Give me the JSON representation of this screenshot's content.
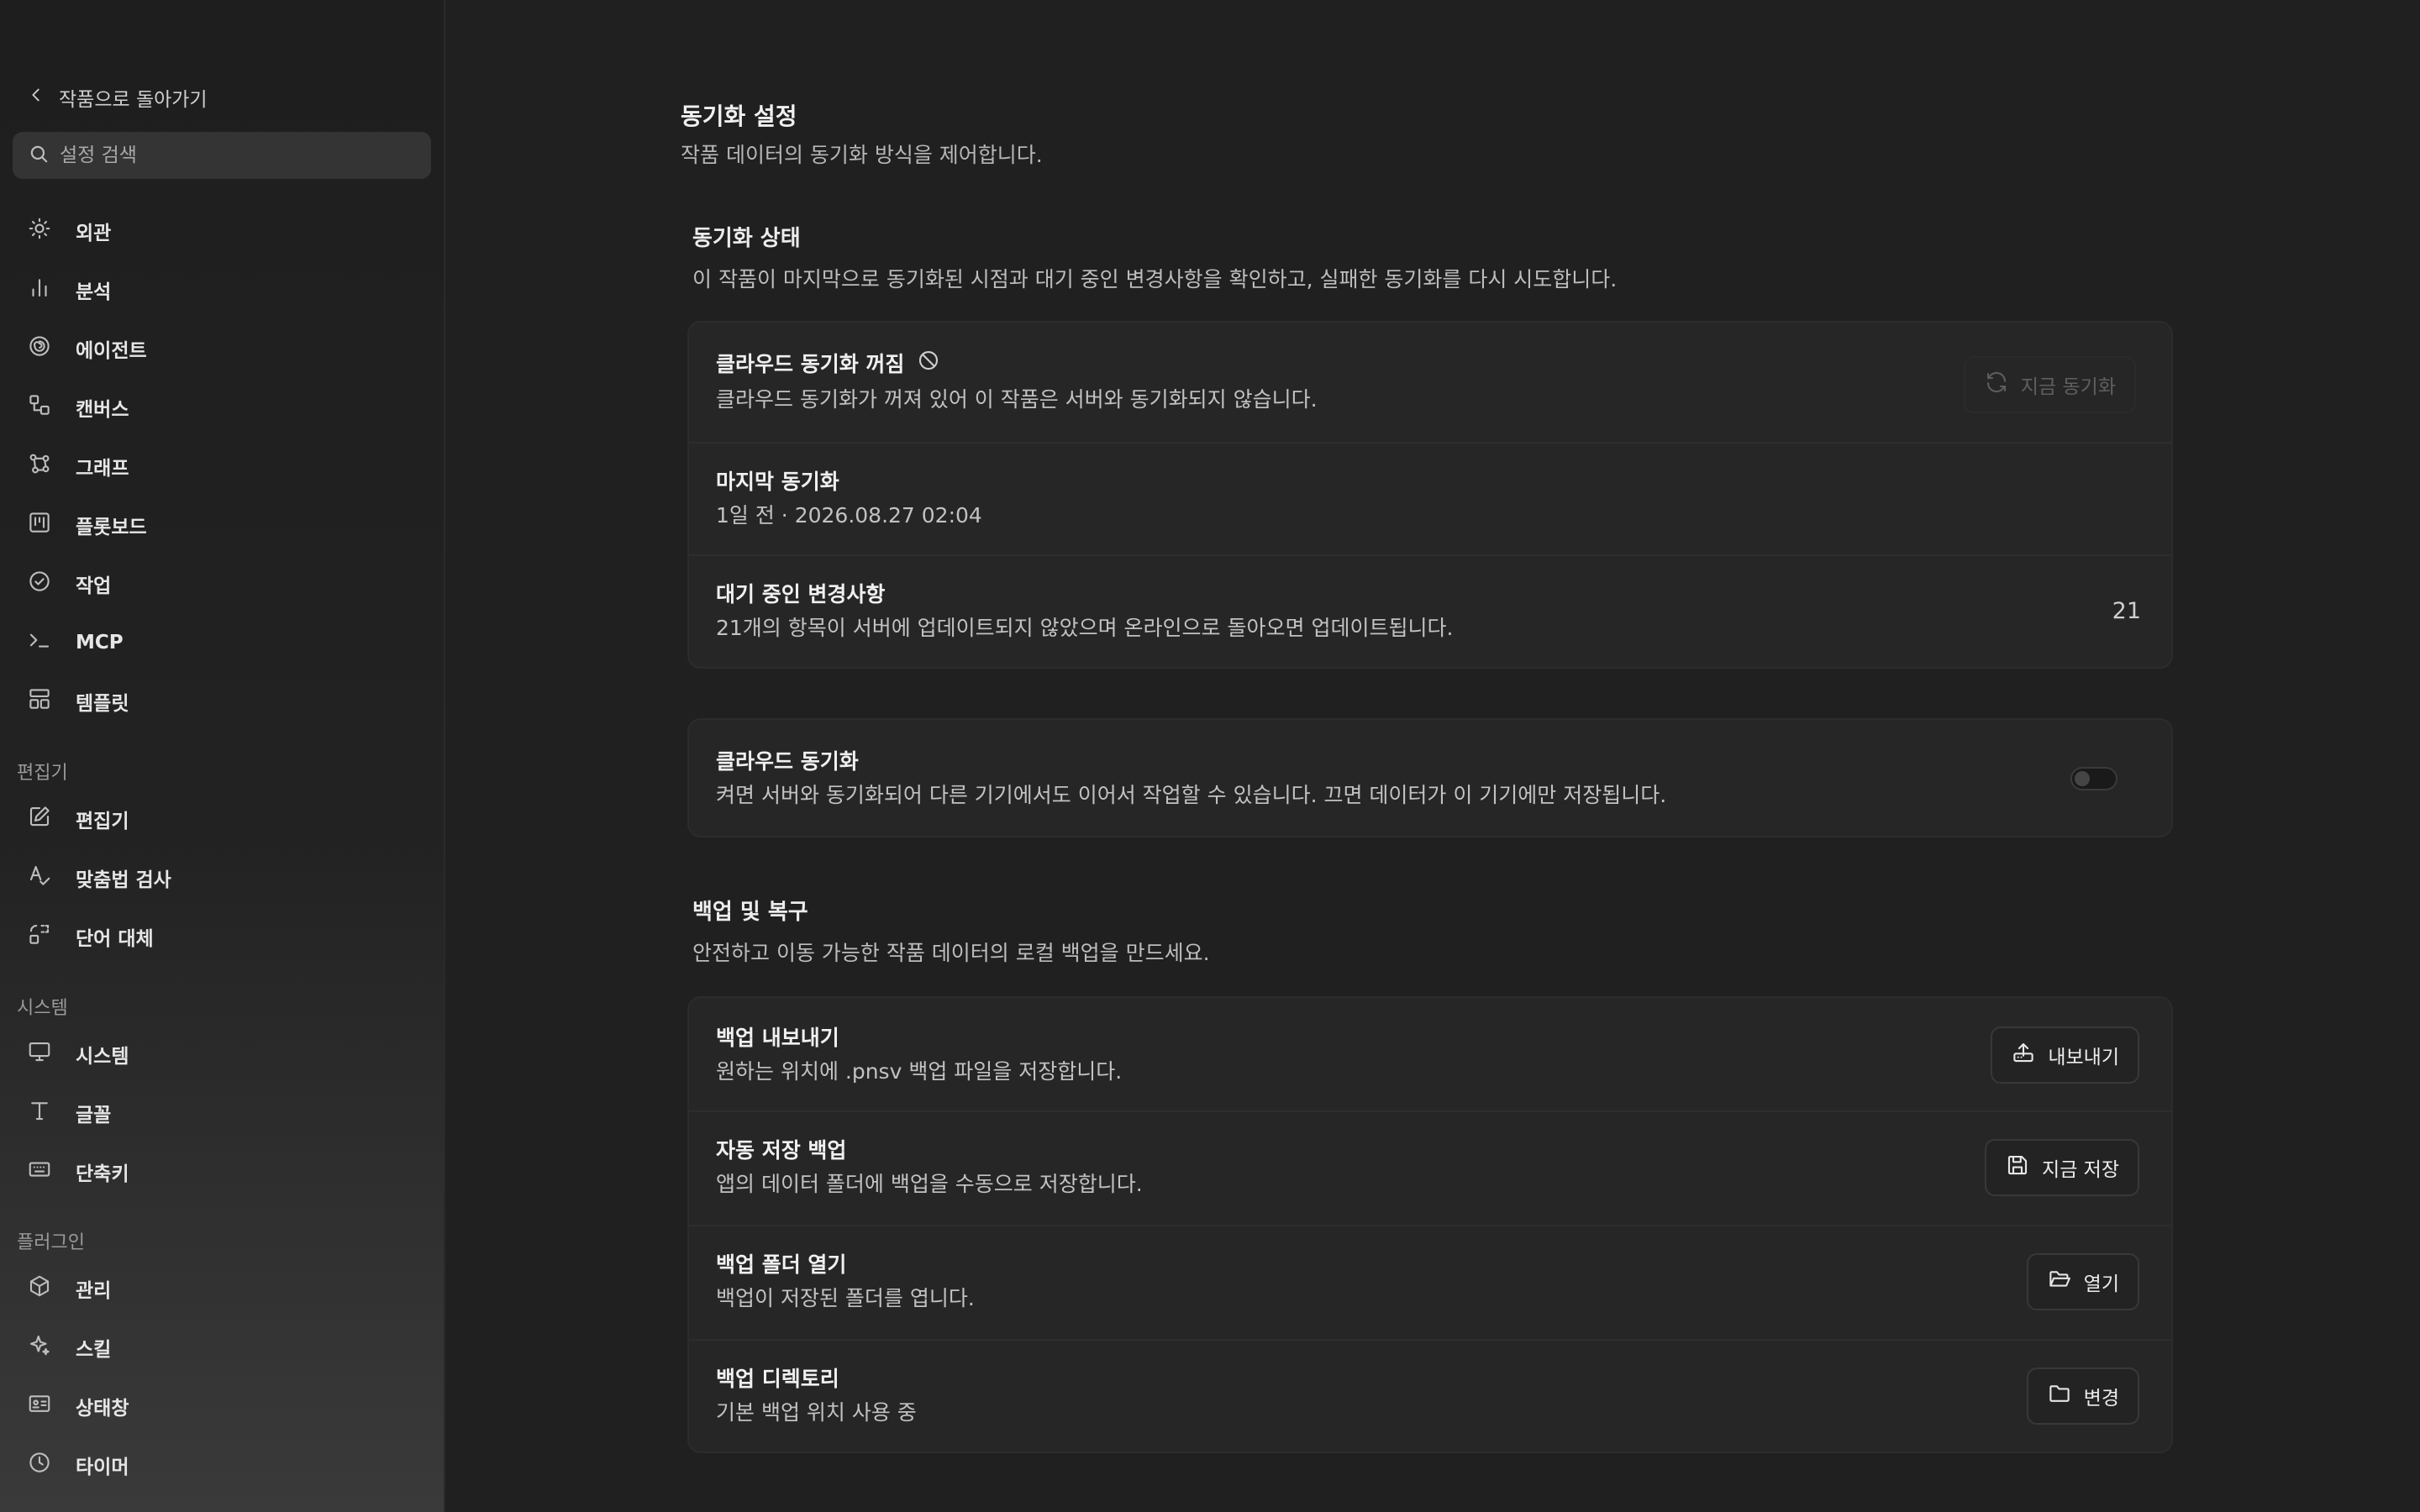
{
  "sidebar": {
    "back_label": "작품으로 돌아가기",
    "search_placeholder": "설정 검색",
    "items": [
      {
        "label": "외관",
        "icon": "sun-icon"
      },
      {
        "label": "분석",
        "icon": "bar-chart-icon"
      },
      {
        "label": "에이전트",
        "icon": "spiral-icon"
      },
      {
        "label": "캔버스",
        "icon": "shapes-icon"
      },
      {
        "label": "그래프",
        "icon": "graph-icon"
      },
      {
        "label": "플롯보드",
        "icon": "kanban-icon"
      },
      {
        "label": "작업",
        "icon": "check-circle-icon"
      },
      {
        "label": "MCP",
        "icon": "terminal-icon"
      },
      {
        "label": "템플릿",
        "icon": "layout-icon"
      }
    ],
    "sections": [
      {
        "title": "편집기",
        "items": [
          {
            "label": "편집기",
            "icon": "edit-icon"
          },
          {
            "label": "맞춤법 검사",
            "icon": "spellcheck-icon"
          },
          {
            "label": "단어 대체",
            "icon": "replace-icon"
          }
        ]
      },
      {
        "title": "시스템",
        "items": [
          {
            "label": "시스템",
            "icon": "monitor-icon"
          },
          {
            "label": "글꼴",
            "icon": "type-icon"
          },
          {
            "label": "단축키",
            "icon": "keyboard-icon"
          }
        ]
      },
      {
        "title": "플러그인",
        "items": [
          {
            "label": "관리",
            "icon": "package-icon"
          },
          {
            "label": "스킬",
            "icon": "sparkles-icon"
          },
          {
            "label": "상태창",
            "icon": "id-card-icon"
          },
          {
            "label": "타이머",
            "icon": "clock-icon"
          }
        ]
      }
    ]
  },
  "main": {
    "title": "동기화 설정",
    "description": "작품 데이터의 동기화 방식을 제어합니다.",
    "sync_status": {
      "title": "동기화 상태",
      "description": "이 작품이 마지막으로 동기화된 시점과 대기 중인 변경사항을 확인하고, 실패한 동기화를 다시 시도합니다.",
      "cloud_off_title": "클라우드 동기화 꺼짐",
      "cloud_off_desc": "클라우드 동기화가 꺼져 있어 이 작품은 서버와 동기화되지 않습니다.",
      "sync_now_label": "지금 동기화",
      "last_sync_title": "마지막 동기화",
      "last_sync_value": "1일 전 · 2026.08.27 02:04",
      "pending_title": "대기 중인 변경사항",
      "pending_desc": "21개의 항목이 서버에 업데이트되지 않았으며 온라인으로 돌아오면 업데이트됩니다.",
      "pending_count": "21"
    },
    "cloud_sync": {
      "title": "클라우드 동기화",
      "description": "켜면 서버와 동기화되어 다른 기기에서도 이어서 작업할 수 있습니다. 끄면 데이터가 이 기기에만 저장됩니다.",
      "enabled": false
    },
    "backup": {
      "title": "백업 및 복구",
      "description": "안전하고 이동 가능한 작품 데이터의 로컬 백업을 만드세요.",
      "rows": [
        {
          "title": "백업 내보내기",
          "desc": "원하는 위치에 .pnsv 백업 파일을 저장합니다.",
          "button": "내보내기",
          "icon": "upload-icon"
        },
        {
          "title": "자동 저장 백업",
          "desc": "앱의 데이터 폴더에 백업을 수동으로 저장합니다.",
          "button": "지금 저장",
          "icon": "save-icon"
        },
        {
          "title": "백업 폴더 열기",
          "desc": "백업이 저장된 폴더를 엽니다.",
          "button": "열기",
          "icon": "folder-open-icon"
        },
        {
          "title": "백업 디렉토리",
          "desc": "기본 백업 위치 사용 중",
          "button": "변경",
          "icon": "folder-icon"
        }
      ]
    }
  }
}
